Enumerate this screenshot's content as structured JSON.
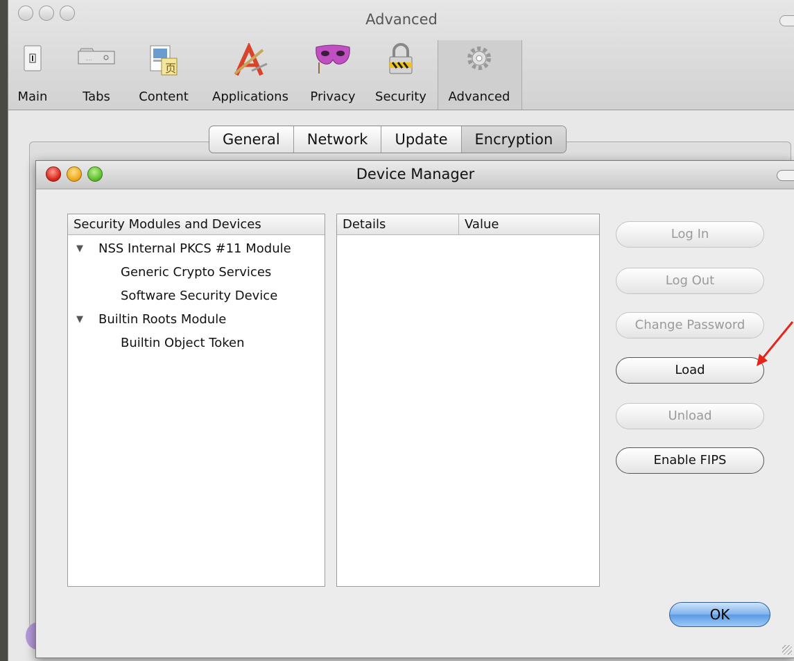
{
  "prefs_window": {
    "title": "Advanced",
    "toolbar": [
      {
        "label": "Main",
        "icon": "switch-icon"
      },
      {
        "label": "Tabs",
        "icon": "tabs-icon"
      },
      {
        "label": "Content",
        "icon": "content-icon"
      },
      {
        "label": "Applications",
        "icon": "applications-icon"
      },
      {
        "label": "Privacy",
        "icon": "mask-icon"
      },
      {
        "label": "Security",
        "icon": "padlock-icon"
      },
      {
        "label": "Advanced",
        "icon": "gear-icon",
        "selected": true
      }
    ],
    "tabs": [
      {
        "label": "General"
      },
      {
        "label": "Network"
      },
      {
        "label": "Update"
      },
      {
        "label": "Encryption",
        "selected": true
      }
    ]
  },
  "device_manager": {
    "title": "Device Manager",
    "modules_header": "Security Modules and Devices",
    "details_header": "Details",
    "value_header": "Value",
    "tree": [
      {
        "label": "NSS Internal PKCS #11 Module",
        "expanded": true,
        "children": [
          {
            "label": "Generic Crypto Services"
          },
          {
            "label": "Software Security Device"
          }
        ]
      },
      {
        "label": "Builtin Roots Module",
        "expanded": true,
        "children": [
          {
            "label": "Builtin Object Token"
          }
        ]
      }
    ],
    "buttons": {
      "log_in": "Log In",
      "log_out": "Log Out",
      "change_password": "Change Password",
      "load": "Load",
      "unload": "Unload",
      "enable_fips": "Enable FIPS",
      "ok": "OK"
    }
  },
  "colors": {
    "annotation_arrow": "#e8231b",
    "ok_button": "#7fb2ec"
  }
}
